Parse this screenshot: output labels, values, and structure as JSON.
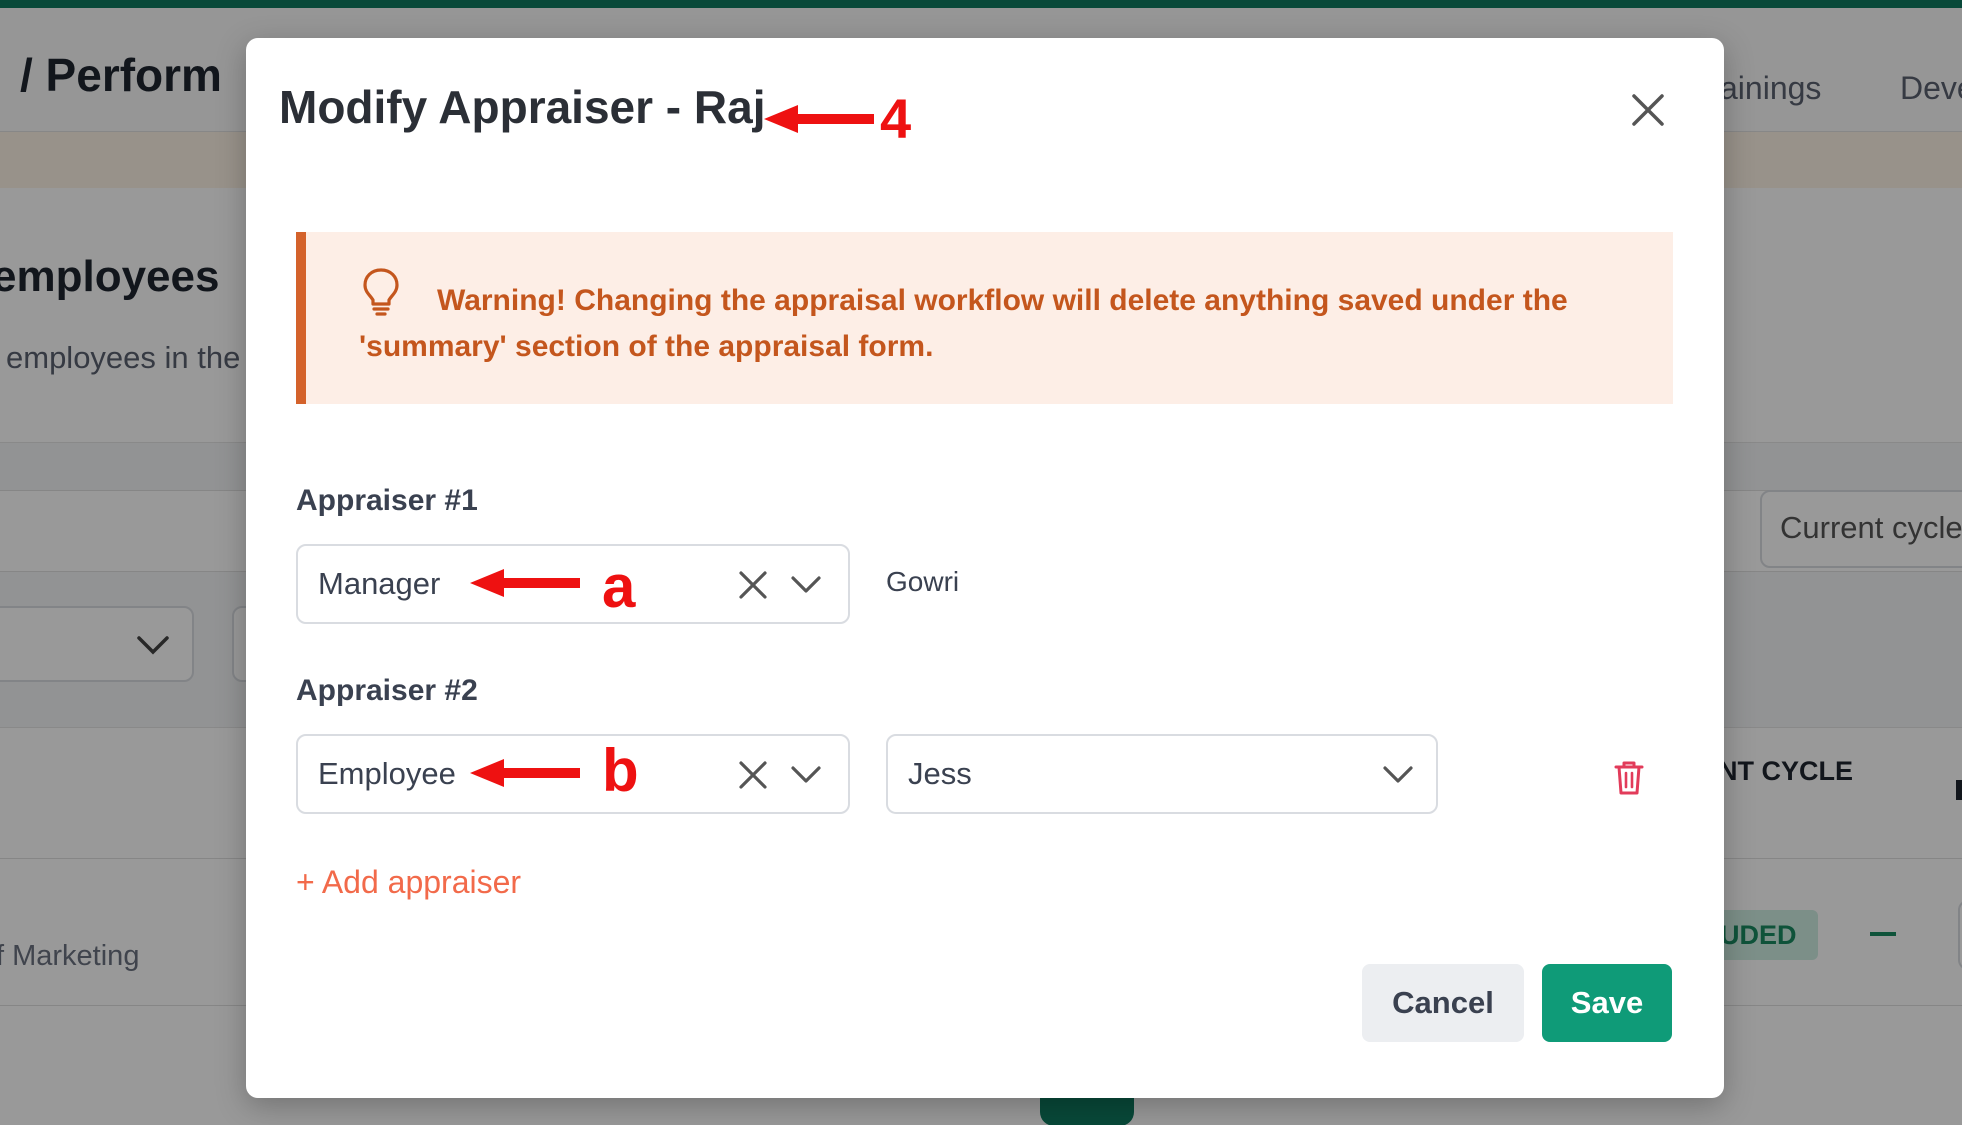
{
  "background": {
    "breadcrumb": "/ Perform",
    "header_tabs": [
      "ainings",
      "Deve"
    ],
    "page_title": "employees",
    "page_subtitle": "employees in the",
    "cycle_filter_value": "Current cycle",
    "column_header": "ENT CYCLE",
    "row_department": "f Marketing",
    "row_status_badge": "UDED"
  },
  "modal": {
    "title": "Modify Appraiser - Raj",
    "warning_text": "Warning! Changing the appraisal workflow will delete anything saved under the 'summary' section of the appraisal form.",
    "appraisers": [
      {
        "label": "Appraiser #1",
        "type_value": "Manager",
        "person": "Gowri"
      },
      {
        "label": "Appraiser #2",
        "type_value": "Employee",
        "person": "Jess"
      }
    ],
    "add_appraiser_label": "+ Add appraiser",
    "cancel_label": "Cancel",
    "save_label": "Save"
  },
  "annotations": {
    "title_marker": "4",
    "appraiser1_marker": "a",
    "appraiser2_marker": "b"
  },
  "colors": {
    "accent_green": "#0f9b78",
    "warning_text": "#c4561d",
    "warning_bg": "#fdeee6",
    "add_link": "#f26a4a",
    "annotation_red": "#ee1111",
    "delete_icon": "#e23b5a"
  }
}
